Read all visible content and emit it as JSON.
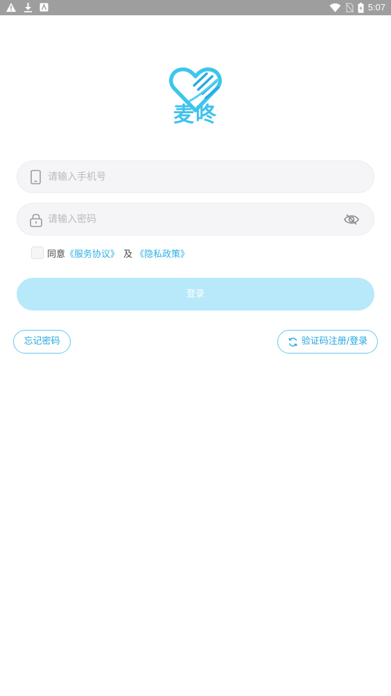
{
  "status_bar": {
    "time": "5:07",
    "left_icons": [
      "warning-icon",
      "download-icon",
      "app-notification-icon"
    ],
    "right_icons": [
      "wifi-icon",
      "no-sim-icon",
      "battery-icon"
    ]
  },
  "brand": {
    "name": "麦咚",
    "color": "#3fc2ec"
  },
  "phone_field": {
    "placeholder": "请输入手机号",
    "icon": "phone-icon"
  },
  "password_field": {
    "placeholder": "请输入密码",
    "icon": "lock-icon",
    "toggle_icon": "eye-icon"
  },
  "agreement": {
    "checked": false,
    "prefix": "同意",
    "service_link": "《服务协议》",
    "and": "及",
    "privacy_link": "《隐私政策》"
  },
  "login_button": {
    "label": "登录"
  },
  "forgot_password": {
    "label": "忘记密码"
  },
  "sms_login": {
    "label": "验证码注册/登录",
    "icon": "refresh-icon"
  }
}
